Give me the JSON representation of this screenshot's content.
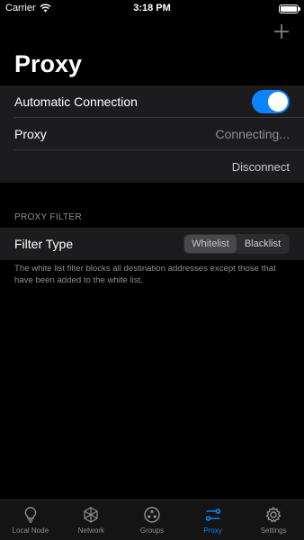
{
  "status_bar": {
    "carrier": "Carrier",
    "time": "3:18 PM"
  },
  "page": {
    "title": "Proxy"
  },
  "connection": {
    "auto_label": "Automatic Connection",
    "auto_enabled": true,
    "proxy_label": "Proxy",
    "proxy_status": "Connecting...",
    "disconnect_label": "Disconnect"
  },
  "filter": {
    "section_header": "PROXY FILTER",
    "type_label": "Filter Type",
    "options": [
      "Whitelist",
      "Blacklist"
    ],
    "selected": "Whitelist",
    "description": "The white list filter blocks all destination addresses except those that have been added to the white list."
  },
  "tab_bar": {
    "tabs": [
      {
        "label": "Local Node",
        "icon": "lightbulb-icon"
      },
      {
        "label": "Network",
        "icon": "network-icon"
      },
      {
        "label": "Groups",
        "icon": "groups-icon"
      },
      {
        "label": "Proxy",
        "icon": "proxy-icon"
      },
      {
        "label": "Settings",
        "icon": "gear-icon"
      }
    ],
    "active": "Proxy"
  },
  "colors": {
    "accent": "#0a84ff",
    "background": "#000000",
    "cell": "#1c1c1e"
  }
}
